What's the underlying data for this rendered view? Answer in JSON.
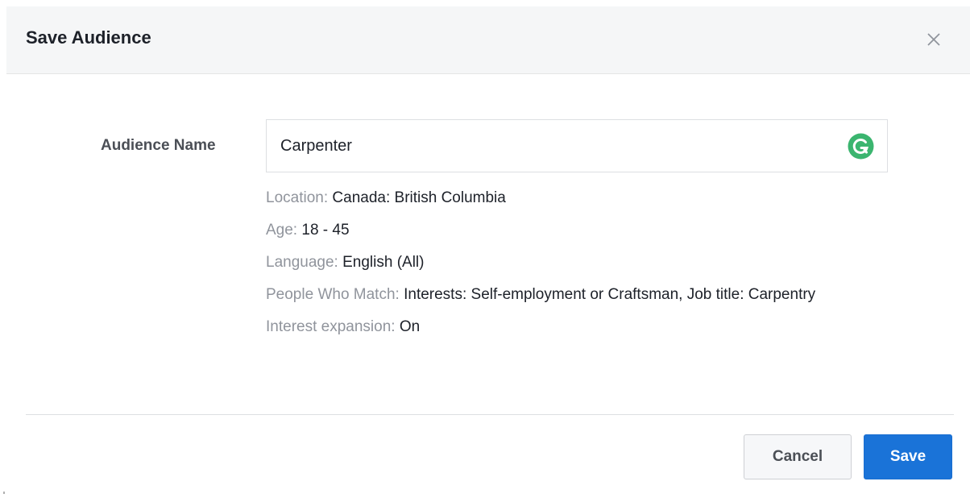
{
  "dialog": {
    "title": "Save Audience",
    "close_icon": "close-icon"
  },
  "form": {
    "name_label": "Audience Name",
    "name_value": "Carpenter",
    "grammarly_icon": "grammarly-icon"
  },
  "summary": [
    {
      "key": "Location:",
      "value": "Canada: British Columbia"
    },
    {
      "key": "Age:",
      "value": "18 - 45"
    },
    {
      "key": "Language:",
      "value": "English (All)"
    },
    {
      "key": "People Who Match:",
      "value": "Interests: Self-employment or Craftsman, Job title: Carpentry"
    },
    {
      "key": "Interest expansion:",
      "value": "On"
    }
  ],
  "footer": {
    "cancel_label": "Cancel",
    "save_label": "Save"
  },
  "colors": {
    "accent": "#1a73d8",
    "header_bg": "#f5f6f7",
    "muted_text": "#90949c",
    "grammarly_green": "#15c39a"
  }
}
